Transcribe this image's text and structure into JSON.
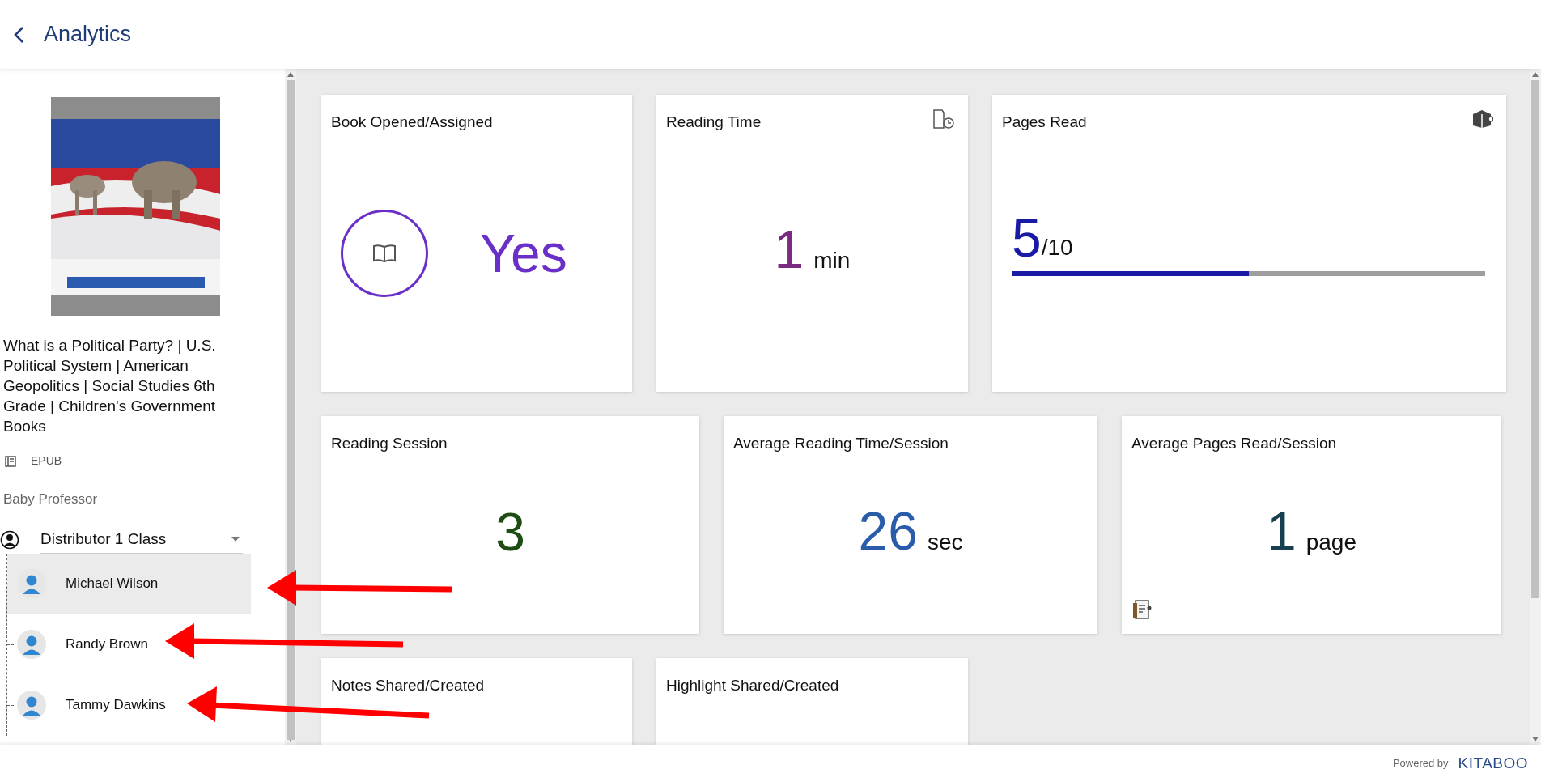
{
  "header": {
    "title": "Analytics"
  },
  "book": {
    "title": "What is a Political Party? | U.S. Political System | American Geopolitics | Social Studies 6th Grade | Children's Government Books",
    "format": "EPUB",
    "publisher": "Baby Professor"
  },
  "class_selector": {
    "value": "Distributor 1 Class"
  },
  "students": [
    {
      "name": "Michael Wilson",
      "selected": true
    },
    {
      "name": "Randy Brown",
      "selected": false
    },
    {
      "name": "Tammy Dawkins",
      "selected": false
    }
  ],
  "card_rows": [
    [
      {
        "kind": "opened",
        "title": "Book Opened/Assigned",
        "value": "Yes",
        "color": "#6a2fc8"
      },
      {
        "kind": "time",
        "title": "Reading Time",
        "value": "1",
        "unit": "min",
        "color": "#7b2a7f"
      },
      {
        "kind": "pages",
        "title": "Pages Read",
        "value": "5",
        "unit": "/10",
        "color": "#1b1aa6",
        "level": 0.5
      }
    ],
    [
      {
        "kind": "count",
        "title": "Reading Session",
        "value": "3",
        "color": "#1e4d14"
      },
      {
        "kind": "count",
        "title": "Average Reading Time/Session",
        "value": "26",
        "unit": "sec",
        "color": "#2a5caa"
      },
      {
        "kind": "avgpages",
        "title": "Average Pages Read/Session",
        "value": "1",
        "unit": "page",
        "color": "#173f4f"
      }
    ],
    [
      {
        "kind": "empty",
        "title": "Notes Shared/Created"
      },
      {
        "kind": "empty",
        "title": "Highlight Shared/Created"
      }
    ]
  ],
  "footer": {
    "powered_by": "Powered by",
    "brand": "KITABOO"
  }
}
